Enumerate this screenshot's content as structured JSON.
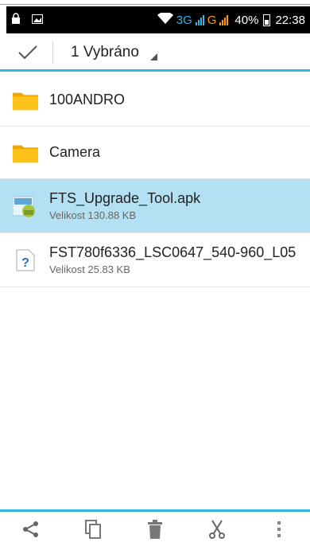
{
  "status_bar": {
    "network_3g": "3G",
    "network_g": "G",
    "battery": "40%",
    "time": "22:38"
  },
  "action_bar": {
    "selection_label": "1 Vybráno"
  },
  "files": [
    {
      "name": "100ANDRO",
      "type": "folder",
      "size": ""
    },
    {
      "name": "Camera",
      "type": "folder",
      "size": ""
    },
    {
      "name": "FTS_Upgrade_Tool.apk",
      "type": "apk",
      "size": "Velikost 130.88 KB",
      "selected": true
    },
    {
      "name": "FST780f6336_LSC0647_540-960_L05",
      "type": "unknown",
      "size": "Velikost 25.83 KB"
    }
  ],
  "bottom_actions": [
    "share-icon",
    "copy-icon",
    "delete-icon",
    "cut-icon",
    "more-icon"
  ],
  "colors": {
    "accent": "#33b5e5",
    "selected_bg": "#b3e1f3",
    "folder": "#f7b500"
  }
}
